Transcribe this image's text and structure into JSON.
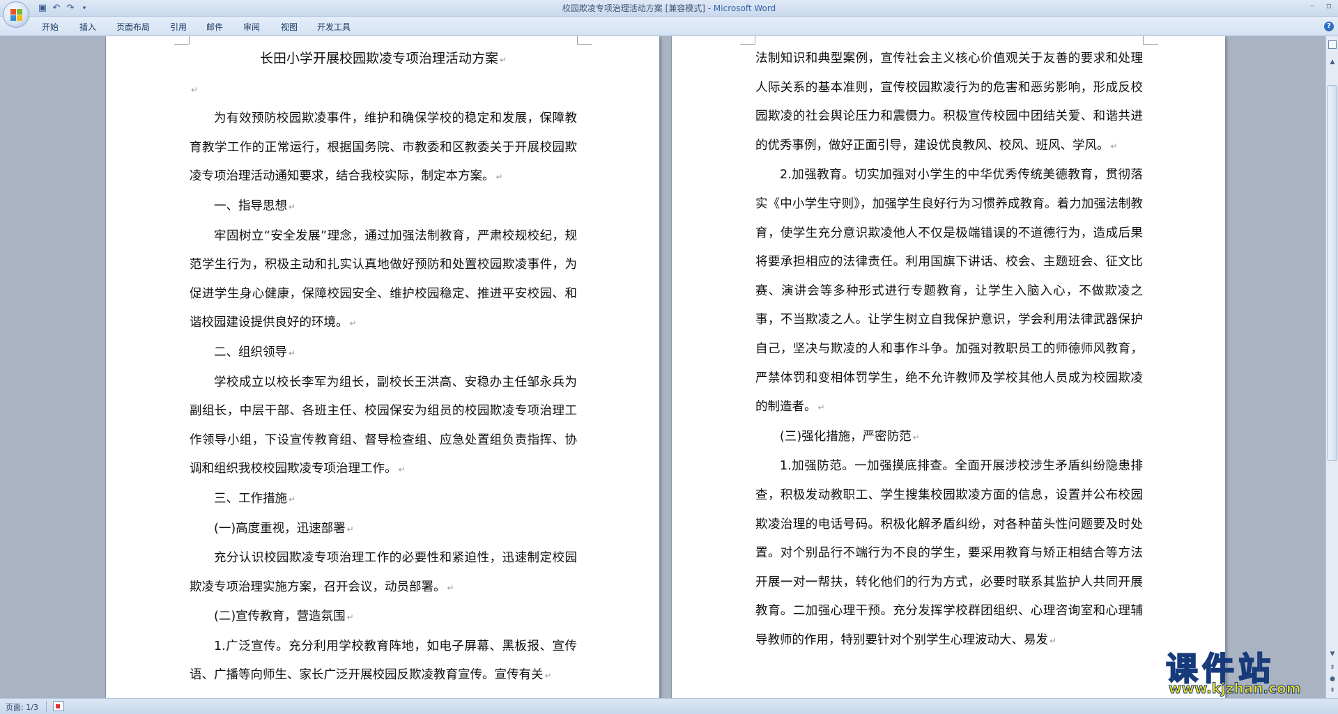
{
  "window": {
    "title": "校园欺凌专项治理活动方案 [兼容模式] - ",
    "app_name": "Microsoft Word"
  },
  "quick_access": {
    "icons": [
      "save-icon",
      "undo-icon",
      "redo-icon",
      "customize-icon"
    ]
  },
  "ribbon": {
    "tabs": [
      "开始",
      "插入",
      "页面布局",
      "引用",
      "邮件",
      "审阅",
      "视图",
      "开发工具"
    ]
  },
  "document": {
    "left_page": [
      {
        "style": "title",
        "text": "长田小学开展校园欺凌专项治理活动方案"
      },
      {
        "style": "empty",
        "text": ""
      },
      {
        "style": "indent",
        "text": "为有效预防校园欺凌事件，维护和确保学校的稳定和发展，保障教育教学工作的正常运行，根据国务院、市教委和区教委关于开展校园欺凌专项治理活动通知要求，结合我校实际，制定本方案。"
      },
      {
        "style": "indent",
        "text": "一、指导思想"
      },
      {
        "style": "indent",
        "text": "牢固树立“安全发展”理念，通过加强法制教育，严肃校规校纪，规范学生行为，积极主动和扎实认真地做好预防和处置校园欺凌事件，为促进学生身心健康，保障校园安全、维护校园稳定、推进平安校园、和谐校园建设提供良好的环境。"
      },
      {
        "style": "indent",
        "text": "二、组织领导"
      },
      {
        "style": "indent",
        "text": "学校成立以校长李军为组长，副校长王洪高、安稳办主任邹永兵为副组长，中层干部、各班主任、校园保安为组员的校园欺凌专项治理工作领导小组，下设宣传教育组、督导检查组、应急处置组负责指挥、协调和组织我校校园欺凌专项治理工作。"
      },
      {
        "style": "indent",
        "text": "三、工作措施"
      },
      {
        "style": "indent",
        "text": "(一)高度重视，迅速部署"
      },
      {
        "style": "indent",
        "text": "充分认识校园欺凌专项治理工作的必要性和紧迫性，迅速制定校园欺凌专项治理实施方案，召开会议，动员部署。"
      },
      {
        "style": "indent",
        "text": "(二)宣传教育，营造氛围"
      },
      {
        "style": "indent",
        "text": "1.广泛宣传。充分利用学校教育阵地，如电子屏幕、黑板报、宣传语、广播等向师生、家长广泛开展校园反欺凌教育宣传。宣传有关"
      }
    ],
    "right_page": [
      {
        "style": "plain",
        "text": "法制知识和典型案例，宣传社会主义核心价值观关于友善的要求和处理人际关系的基本准则，宣传校园欺凌行为的危害和恶劣影响，形成反校园欺凌的社会舆论压力和震慑力。积极宣传校园中团结关爱、和谐共进的优秀事例，做好正面引导，建设优良教风、校风、班风、学风。"
      },
      {
        "style": "indent",
        "text": "2.加强教育。切实加强对小学生的中华优秀传统美德教育，贯彻落实《中小学生守则》，加强学生良好行为习惯养成教育。着力加强法制教育，使学生充分意识欺凌他人不仅是极端错误的不道德行为，造成后果将要承担相应的法律责任。利用国旗下讲话、校会、主题班会、征文比赛、演讲会等多种形式进行专题教育，让学生入脑入心，不做欺凌之事，不当欺凌之人。让学生树立自我保护意识，学会利用法律武器保护自己，坚决与欺凌的人和事作斗争。加强对教职员工的师德师风教育，严禁体罚和变相体罚学生，绝不允许教师及学校其他人员成为校园欺凌的制造者。"
      },
      {
        "style": "indent",
        "text": "(三)强化措施，严密防范"
      },
      {
        "style": "indent",
        "text": "1.加强防范。一加强摸底排查。全面开展涉校涉生矛盾纠纷隐患排查，积极发动教职工、学生搜集校园欺凌方面的信息，设置并公布校园欺凌治理的电话号码。积极化解矛盾纠纷，对各种苗头性问题要及时处置。对个别品行不端行为不良的学生，要采用教育与矫正相结合等方法开展一对一帮扶，转化他们的行为方式，必要时联系其监护人共同开展教育。二加强心理干预。充分发挥学校群团组织、心理咨询室和心理辅导教师的作用，特别要针对个别学生心理波动大、易发"
      }
    ],
    "paragraph_mark": "↵"
  },
  "status_bar": {
    "page_info": "页面: 1/3"
  },
  "watermark": {
    "text": "课件站",
    "url": "www.kjzhan.com"
  },
  "colors": {
    "ribbon_bg": "#d5e2f3",
    "workspace_bg": "#a9b3c2",
    "app_name": "#3b66a8",
    "watermark_fill": "#f2e01a",
    "watermark_stroke": "#173a7a"
  }
}
